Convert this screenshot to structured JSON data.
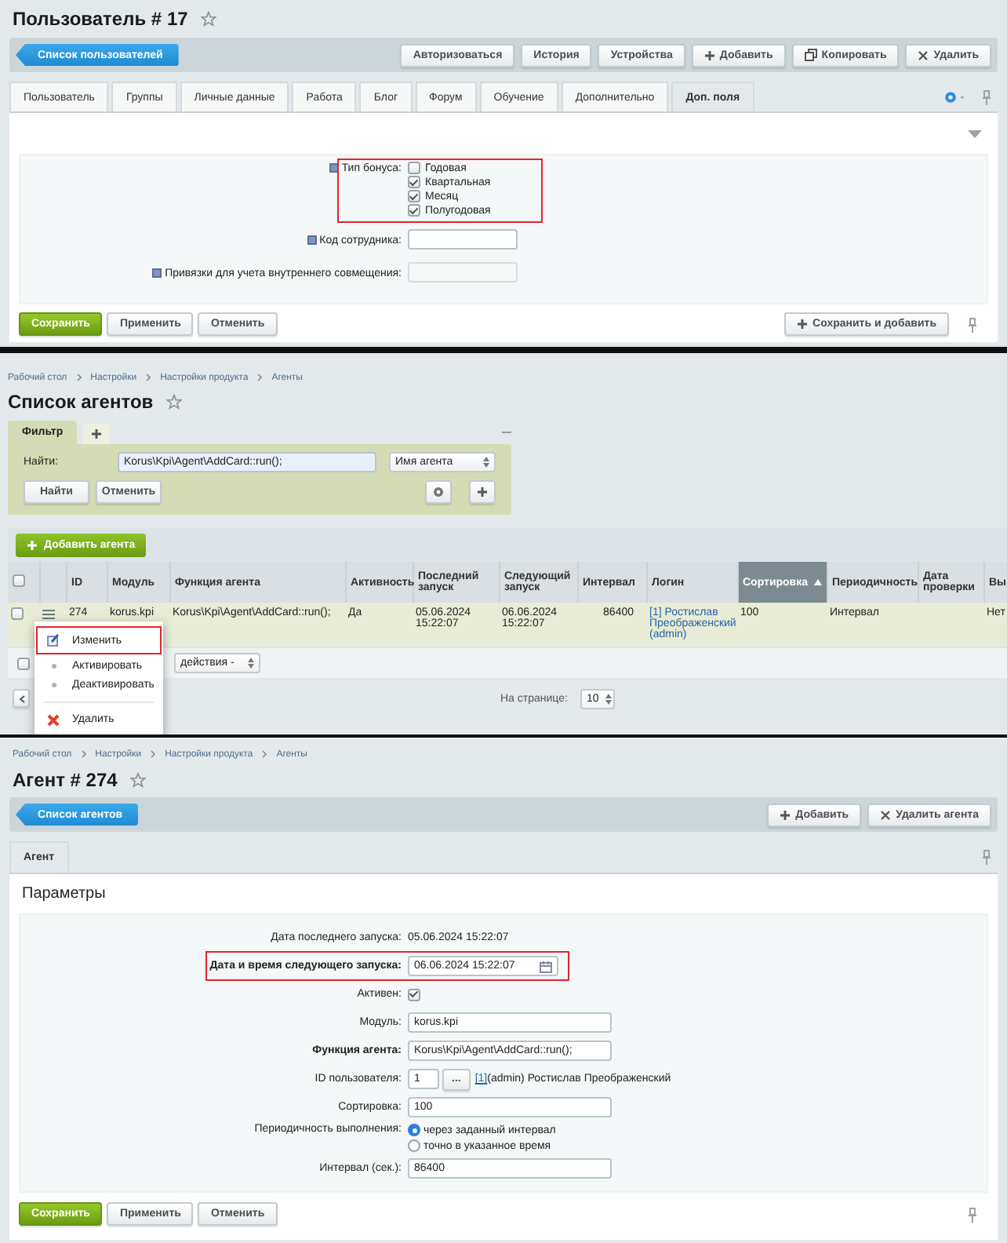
{
  "user_panel": {
    "title": "Пользователь # 17",
    "back_button": "Список пользователей",
    "toolbar_buttons": [
      {
        "label": "Авторизоваться",
        "kind": "plain"
      },
      {
        "label": "История",
        "kind": "plain"
      },
      {
        "label": "Устройства",
        "kind": "plain"
      },
      {
        "label": "Добавить",
        "kind": "add"
      },
      {
        "label": "Копировать",
        "kind": "copy"
      },
      {
        "label": "Удалить",
        "kind": "delete"
      }
    ],
    "tabs": [
      {
        "label": "Пользователь",
        "selected": false
      },
      {
        "label": "Группы",
        "selected": false
      },
      {
        "label": "Личные данные",
        "selected": false
      },
      {
        "label": "Работа",
        "selected": false
      },
      {
        "label": "Блог",
        "selected": false
      },
      {
        "label": "Форум",
        "selected": false
      },
      {
        "label": "Обучение",
        "selected": false
      },
      {
        "label": "Дополнительно",
        "selected": false
      },
      {
        "label": "Доп. поля",
        "selected": true
      }
    ],
    "bonus_field": {
      "label": "Тип бонуса:",
      "highlighted": true,
      "options": [
        {
          "label": "Годовая",
          "checked": false
        },
        {
          "label": "Квартальная",
          "checked": true
        },
        {
          "label": "Месяц",
          "checked": true
        },
        {
          "label": "Полугодовая",
          "checked": true
        }
      ]
    },
    "fields": [
      {
        "label": "Код сотрудника:",
        "disabled": false
      },
      {
        "label": "Привязки для учета внутреннего совмещения:",
        "disabled": true
      }
    ],
    "footer_buttons": [
      {
        "label": "Сохранить",
        "kind": "primary"
      },
      {
        "label": "Применить",
        "kind": "plain"
      },
      {
        "label": "Отменить",
        "kind": "plain"
      }
    ],
    "save_add_button": "Сохранить и добавить"
  },
  "agents_panel": {
    "breadcrumbs": [
      "Рабочий стол",
      "Настройки",
      "Настройки продукта",
      "Агенты"
    ],
    "title": "Список агентов",
    "filter": {
      "tab": "Фильтр",
      "find_label": "Найти:",
      "find_value": "Korus\\Kpi\\Agent\\AddCard::run();",
      "field_select": "Имя агента",
      "buttons": [
        "Найти",
        "Отменить"
      ]
    },
    "add_button": "Добавить агента",
    "table": {
      "header_checked": false,
      "columns": [
        {
          "label": "ID",
          "kind": "text",
          "sorted": false
        },
        {
          "label": "Модуль",
          "kind": "text",
          "sorted": false
        },
        {
          "label": "Функция агента",
          "kind": "text",
          "sorted": false
        },
        {
          "label": "Активность",
          "kind": "text",
          "sorted": false
        },
        {
          "label": "Последний запуск",
          "kind": "text",
          "sorted": false
        },
        {
          "label": "Следующий запуск",
          "kind": "text",
          "sorted": false
        },
        {
          "label": "Интервал",
          "kind": "number",
          "sorted": false
        },
        {
          "label": "Логин",
          "kind": "link",
          "sorted": false
        },
        {
          "label": "Сортировка",
          "kind": "text",
          "sorted": true
        },
        {
          "label": "Периодичность",
          "kind": "text",
          "sorted": false
        },
        {
          "label": "Дата проверки",
          "kind": "text",
          "sorted": false
        },
        {
          "label": "Вы",
          "kind": "text",
          "sorted": false
        }
      ],
      "rows": [
        {
          "checked": false,
          "cells": [
            "274",
            "korus.kpi",
            "Korus\\Kpi\\Agent\\AddCard::run();",
            "Да",
            "05.06.2024 15:22:07",
            "06.06.2024 15:22:07",
            "86400",
            "[1] Ростислав Преображенский (admin)",
            "100",
            "Интервал",
            null,
            "Нет"
          ]
        }
      ]
    },
    "actions": {
      "checked": false,
      "select": "действия -"
    },
    "pagination": {
      "per_page_label": "На странице:",
      "per_page": "10"
    },
    "context_menu": [
      {
        "label": "Изменить",
        "kind": "edit",
        "highlighted": true
      },
      {
        "label": "Активировать",
        "kind": "action",
        "highlighted": false
      },
      {
        "label": "Деактивировать",
        "kind": "action",
        "highlighted": false
      },
      {
        "label": "Удалить",
        "kind": "delete",
        "highlighted": false
      }
    ]
  },
  "agent_panel": {
    "breadcrumbs": [
      "Рабочий стол",
      "Настройки",
      "Настройки продукта",
      "Агенты"
    ],
    "title": "Агент # 274",
    "back_button": "Список агентов",
    "toolbar_buttons": [
      {
        "label": "Добавить",
        "kind": "add"
      },
      {
        "label": "Удалить агента",
        "kind": "delete"
      }
    ],
    "tabs": [
      {
        "label": "Агент",
        "selected": true
      }
    ],
    "section_title": "Параметры",
    "fields": [
      {
        "kind": "text",
        "label": "Дата последнего запуска:",
        "value": "05.06.2024 15:22:07",
        "required": false,
        "highlighted": false
      },
      {
        "kind": "date",
        "label": "Дата и время следующего запуска:",
        "value": "06.06.2024 15:22:07",
        "required": true,
        "highlighted": true
      },
      {
        "kind": "checkbox",
        "label": "Активен:",
        "checked": true,
        "required": false,
        "highlighted": false
      },
      {
        "kind": "input",
        "label": "Модуль:",
        "value": "korus.kpi",
        "required": false,
        "highlighted": false
      },
      {
        "kind": "input",
        "label": "Функция агента:",
        "value": "Korus\\Kpi\\Agent\\AddCard::run();",
        "required": true,
        "highlighted": false
      },
      {
        "kind": "user",
        "label": "ID пользователя:",
        "value": "1",
        "button": "...",
        "link": "[1]",
        "user_name": "(admin) Ростислав Преображенский",
        "required": false,
        "highlighted": false
      },
      {
        "kind": "input",
        "label": "Сортировка:",
        "value": "100",
        "required": false,
        "highlighted": false
      },
      {
        "kind": "radio",
        "label": "Периодичность выполнения:",
        "required": false,
        "highlighted": false,
        "options": [
          {
            "label": "через заданный интервал",
            "selected": true
          },
          {
            "label": "точно в указанное время",
            "selected": false
          }
        ]
      },
      {
        "kind": "input",
        "label": "Интервал (сек.):",
        "value": "86400",
        "required": false,
        "highlighted": false
      }
    ],
    "footer_buttons": [
      {
        "label": "Сохранить",
        "kind": "primary"
      },
      {
        "label": "Применить",
        "kind": "plain"
      },
      {
        "label": "Отменить",
        "kind": "plain"
      }
    ]
  }
}
